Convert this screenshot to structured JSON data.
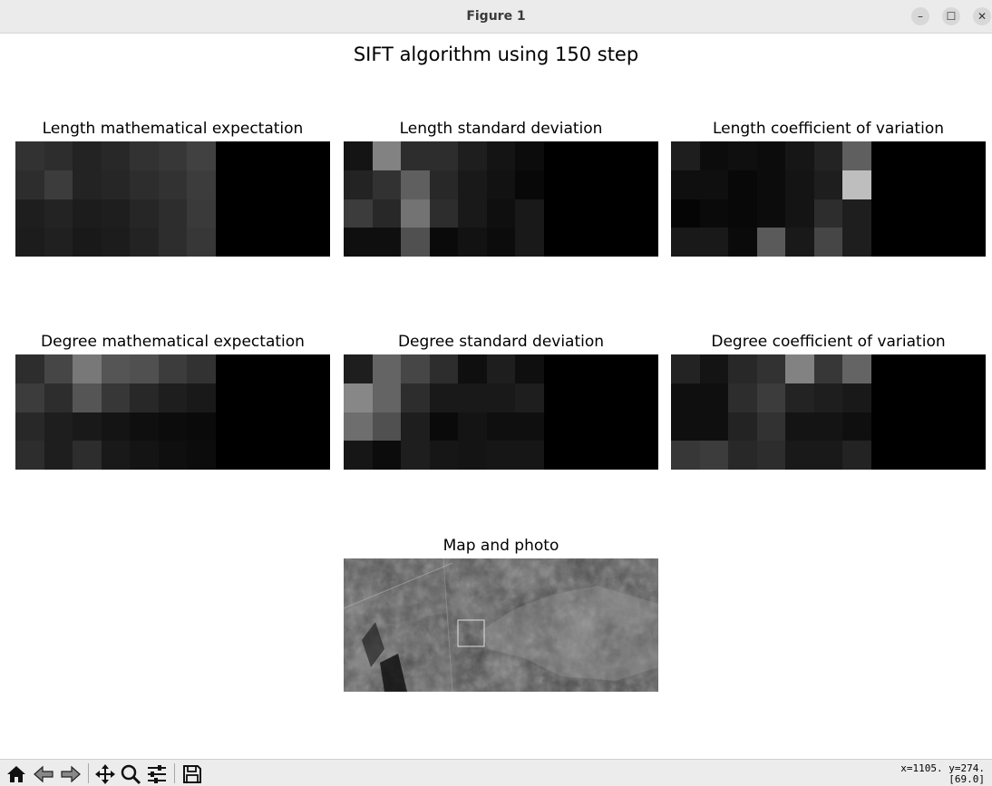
{
  "window": {
    "title": "Figure 1",
    "minimize_glyph": "–",
    "maximize_glyph": "☐",
    "close_glyph": "✕"
  },
  "figure": {
    "suptitle": "SIFT algorithm using 150 step",
    "panels": [
      {
        "title": "Length mathematical expectation",
        "grid": [
          [
            50,
            45,
            35,
            40,
            50,
            55,
            65,
            0,
            0,
            0,
            0
          ],
          [
            45,
            60,
            35,
            38,
            45,
            50,
            60,
            0,
            0,
            0,
            0
          ],
          [
            30,
            35,
            28,
            30,
            38,
            45,
            58,
            0,
            0,
            0,
            0
          ],
          [
            28,
            32,
            25,
            28,
            35,
            45,
            55,
            0,
            0,
            0,
            0
          ]
        ]
      },
      {
        "title": "Length standard deviation",
        "grid": [
          [
            20,
            130,
            45,
            45,
            30,
            20,
            12,
            0,
            0,
            0,
            0
          ],
          [
            35,
            50,
            95,
            40,
            25,
            18,
            8,
            0,
            0,
            0,
            0
          ],
          [
            60,
            40,
            115,
            45,
            25,
            15,
            25,
            0,
            0,
            0,
            0
          ],
          [
            15,
            15,
            80,
            10,
            18,
            12,
            25,
            0,
            0,
            0,
            0
          ]
        ]
      },
      {
        "title": "Length coefficient of variation",
        "grid": [
          [
            30,
            12,
            15,
            12,
            22,
            35,
            95,
            0,
            0,
            0,
            0
          ],
          [
            15,
            15,
            8,
            12,
            20,
            30,
            190,
            0,
            0,
            0,
            0
          ],
          [
            5,
            10,
            8,
            12,
            20,
            45,
            30,
            0,
            0,
            0,
            0
          ],
          [
            25,
            25,
            10,
            90,
            25,
            70,
            30,
            0,
            0,
            0,
            0
          ]
        ]
      },
      {
        "title": "Degree mathematical expectation",
        "grid": [
          [
            45,
            70,
            120,
            85,
            80,
            60,
            50,
            0,
            0,
            0,
            0
          ],
          [
            60,
            45,
            85,
            55,
            40,
            30,
            25,
            0,
            0,
            0,
            0
          ],
          [
            40,
            30,
            25,
            20,
            15,
            12,
            10,
            0,
            0,
            0,
            0
          ],
          [
            45,
            30,
            45,
            25,
            20,
            15,
            12,
            0,
            0,
            0,
            0
          ]
        ]
      },
      {
        "title": "Degree standard deviation",
        "grid": [
          [
            30,
            100,
            70,
            45,
            15,
            30,
            15,
            0,
            0,
            0,
            0
          ],
          [
            135,
            100,
            45,
            25,
            25,
            25,
            30,
            0,
            0,
            0,
            0
          ],
          [
            110,
            80,
            30,
            10,
            20,
            15,
            15,
            0,
            0,
            0,
            0
          ],
          [
            22,
            12,
            30,
            22,
            20,
            22,
            22,
            0,
            0,
            0,
            0
          ]
        ]
      },
      {
        "title": "Degree coefficient of variation",
        "grid": [
          [
            35,
            20,
            40,
            50,
            130,
            55,
            100,
            0,
            0,
            0,
            0
          ],
          [
            15,
            15,
            45,
            60,
            35,
            30,
            25,
            0,
            0,
            0,
            0
          ],
          [
            15,
            15,
            35,
            50,
            20,
            20,
            15,
            0,
            0,
            0,
            0
          ],
          [
            55,
            60,
            40,
            45,
            25,
            25,
            35,
            0,
            0,
            0,
            0
          ]
        ]
      }
    ],
    "photo_title": "Map and photo"
  },
  "toolbar": {
    "tools": [
      {
        "name": "home-icon"
      },
      {
        "name": "back-icon"
      },
      {
        "name": "forward-icon"
      },
      {
        "name": "pan-icon"
      },
      {
        "name": "zoom-icon"
      },
      {
        "name": "configure-subplots-icon"
      },
      {
        "name": "save-icon"
      }
    ],
    "coords_line1": "x=1105. y=274.",
    "coords_line2": "[69.0]"
  }
}
